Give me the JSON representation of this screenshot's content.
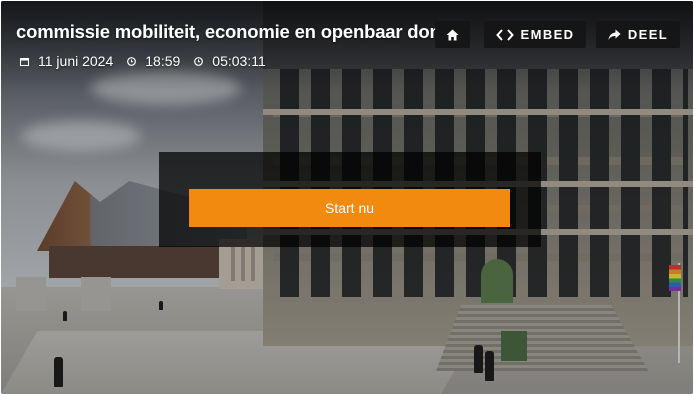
{
  "player": {
    "title": "commissie mobiliteit, economie en openbaar domein",
    "date": "11 juni 2024",
    "time": "18:59",
    "duration": "05:03:11"
  },
  "toolbar": {
    "home_icon": "home-icon",
    "embed_label": "EMBED",
    "embed_icon": "code-brackets-icon",
    "share_label": "DEEL",
    "share_icon": "share-arrow-icon"
  },
  "start": {
    "label": "Start nu"
  },
  "colors": {
    "accent": "#f28a0f",
    "overlay": "#141416"
  }
}
